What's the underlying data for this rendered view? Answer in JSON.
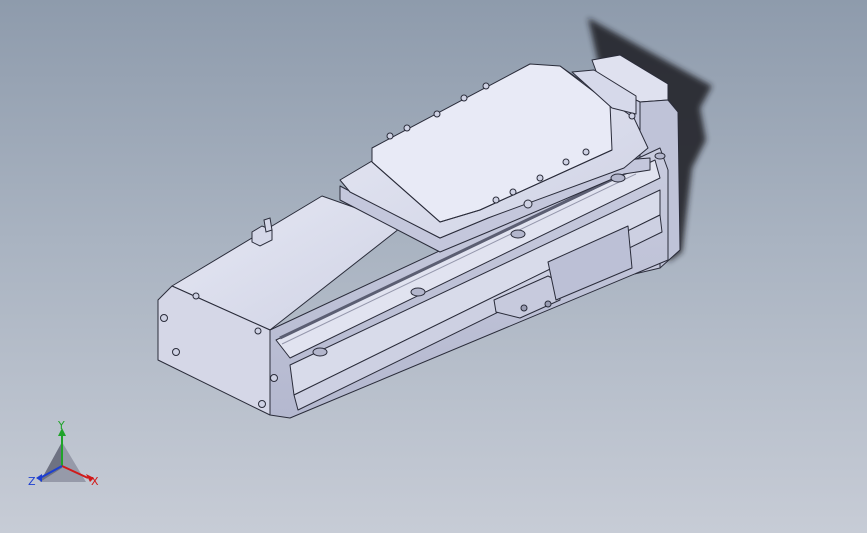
{
  "viewport": {
    "background_top": "#8e9bac",
    "background_bottom": "#c7ccd6",
    "model_fill": "#d9dbeb",
    "model_edge": "#2a2c3a"
  },
  "triad": {
    "y_label": "Y",
    "x_label": "X",
    "z_label": "Z",
    "y_color": "#1fa32a",
    "x_color": "#d11a1a",
    "z_color": "#1d3fd1"
  }
}
